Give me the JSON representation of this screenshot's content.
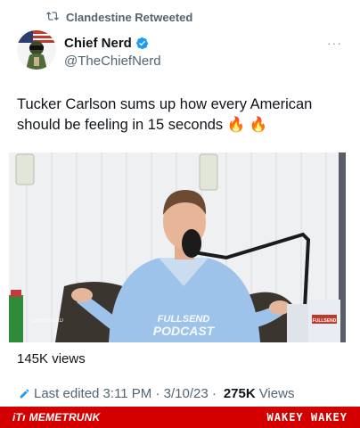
{
  "retweet": {
    "label": "Clandestine Retweeted",
    "icon": "retweet-icon"
  },
  "author": {
    "name": "Chief Nerd",
    "handle": "@TheChiefNerd",
    "verified_icon": "verified-badge-icon",
    "more_label": "···"
  },
  "tweet": {
    "line1": "Tucker Carlson sums up how every American",
    "line2": "should be feeling in 15 seconds",
    "emoji": "🔥 🔥"
  },
  "media": {
    "watermark": "CHIEFNERD",
    "podcast_line1": "FULLSEND",
    "podcast_line2": "PODCAST",
    "can_label": "FULLSEND"
  },
  "stats": {
    "views": "145K views",
    "edited_label": "Last edited 3:11 PM · 3/10/23 ·",
    "view_count": "275K",
    "view_word": "Views"
  },
  "footer": {
    "brand_icon": "iTı",
    "brand": "MEMETRUNK",
    "slogan": "WAKEY WAKEY",
    "bg_color": "#d40000"
  },
  "colors": {
    "accent": "#1d9bf0",
    "muted": "#536471"
  }
}
